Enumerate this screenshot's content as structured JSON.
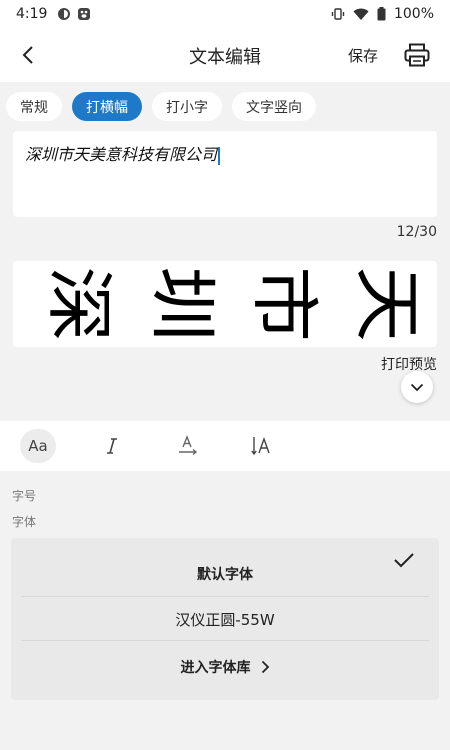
{
  "status": {
    "time": "4:19",
    "battery": "100%"
  },
  "header": {
    "title": "文本编辑",
    "save_label": "保存"
  },
  "tabs": [
    {
      "label": "常规"
    },
    {
      "label": "打横幅"
    },
    {
      "label": "打小字"
    },
    {
      "label": "文字竖向"
    }
  ],
  "active_tab_index": 1,
  "editor": {
    "value": "深圳市天美意科技有限公司",
    "counter": "12/30"
  },
  "preview": {
    "chars": [
      "深",
      "圳",
      "市",
      "天"
    ],
    "label": "打印预览"
  },
  "toolbar": {
    "font_tool_label": "Aa",
    "active_tool": "font"
  },
  "settings": {
    "size_label": "字号",
    "font_label": "字体"
  },
  "fonts": {
    "items": [
      {
        "label": "默认字体",
        "selected": true
      },
      {
        "label": "汉仪正圆-55W",
        "selected": false
      }
    ],
    "library_label": "进入字体库"
  },
  "colors": {
    "accent": "#1f79c9",
    "background": "#f2f2f2",
    "panel": "#e9e9e9"
  },
  "icons": [
    "back-arrow-icon",
    "printer-icon",
    "chevron-down-icon",
    "italic-icon",
    "text-direction-icon",
    "vertical-text-icon",
    "check-icon",
    "chevron-right-icon",
    "wifi-icon",
    "signal-icon",
    "battery-icon",
    "vibrate-icon"
  ]
}
